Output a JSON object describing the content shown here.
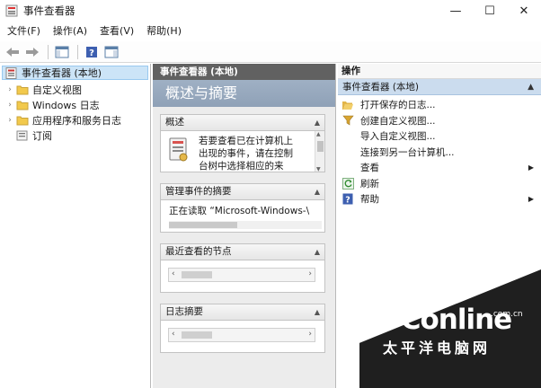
{
  "window": {
    "title": "事件查看器",
    "minimize": "—",
    "maximize": "☐",
    "close": "✕"
  },
  "menubar": {
    "items": [
      "文件(F)",
      "操作(A)",
      "查看(V)",
      "帮助(H)"
    ]
  },
  "tree": {
    "root": "事件查看器 (本地)",
    "items": [
      "自定义视图",
      "Windows 日志",
      "应用程序和服务日志",
      "订阅"
    ]
  },
  "center": {
    "header": "事件查看器 (本地)",
    "banner": "概述与摘要",
    "sections": {
      "overview_title": "概述",
      "overview_lines": [
        "若要查看已在计算机上",
        "出现的事件，请在控制",
        "台树中选择相应的来"
      ],
      "summary_title": "管理事件的摘要",
      "summary_text": "正在读取 “Microsoft-Windows-\\",
      "recent_title": "最近查看的节点",
      "log_title": "日志摘要"
    }
  },
  "actions": {
    "header": "操作",
    "section": "事件查看器 (本地)",
    "items": [
      "打开保存的日志...",
      "创建自定义视图...",
      "导入自定义视图...",
      "连接到另一台计算机...",
      "查看",
      "刷新",
      "帮助"
    ]
  },
  "watermark": {
    "brand": "PConline",
    "domain": ".com.cn",
    "chinese": "太平洋电脑网"
  },
  "colors": {
    "selection": "#cce4f7",
    "action_section": "#cbdcee",
    "center_header": "#616161",
    "banner": "#9fb0c4"
  }
}
